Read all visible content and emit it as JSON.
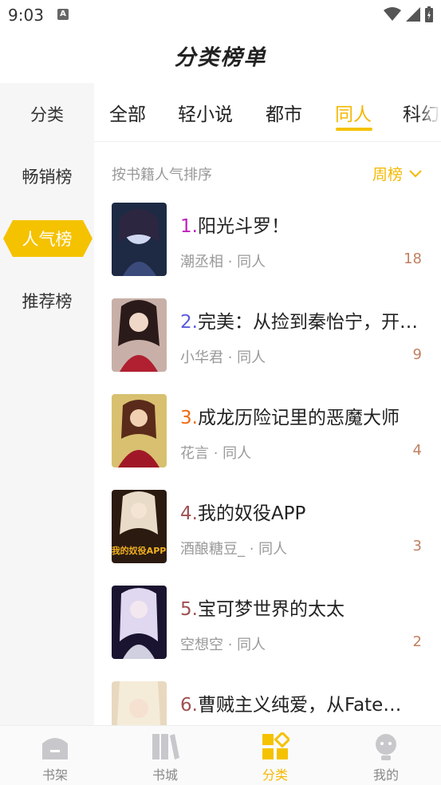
{
  "status": {
    "time": "9:03"
  },
  "header": {
    "title": "分类榜单"
  },
  "sidebar": {
    "items": [
      {
        "label": "分类"
      },
      {
        "label": "畅销榜"
      },
      {
        "label": "人气榜"
      },
      {
        "label": "推荐榜"
      }
    ],
    "active_index": 2
  },
  "tabs": [
    {
      "label": "全部"
    },
    {
      "label": "轻小说"
    },
    {
      "label": "都市"
    },
    {
      "label": "同人"
    },
    {
      "label": "科幻"
    }
  ],
  "sort": {
    "label": "按书籍人气排序",
    "selected": "周榜"
  },
  "books": [
    {
      "rank": "1.",
      "title": "阳光斗罗！",
      "meta": "潮丞相 · 同人",
      "count": "18",
      "rank_color": "#c020c0"
    },
    {
      "rank": "2.",
      "title": "完美：从捡到秦怡宁，开始无敌",
      "meta": "小华君 · 同人",
      "count": "9",
      "rank_color": "#5a5ae0"
    },
    {
      "rank": "3.",
      "title": "成龙历险记里的恶魔大师",
      "meta": "花言 · 同人",
      "count": "4",
      "rank_color": "#f06a10"
    },
    {
      "rank": "4.",
      "title": "我的奴役APP",
      "meta": "酒酿糖豆_ · 同人",
      "count": "3",
      "rank_color": "#a05050"
    },
    {
      "rank": "5.",
      "title": "宝可梦世界的太太",
      "meta": "空想空 · 同人",
      "count": "2",
      "rank_color": "#a05050"
    },
    {
      "rank": "6.",
      "title": "曹贼主义纯爱，从Fate开始",
      "meta": "",
      "count": "",
      "rank_color": "#a05050"
    }
  ],
  "cover4_text": "我的奴役APP",
  "bottom_nav": [
    {
      "label": "书架"
    },
    {
      "label": "书城"
    },
    {
      "label": "分类"
    },
    {
      "label": "我的"
    }
  ],
  "colors": {
    "accent": "#f5b800",
    "sidebar_bg": "#f6f6f6"
  }
}
